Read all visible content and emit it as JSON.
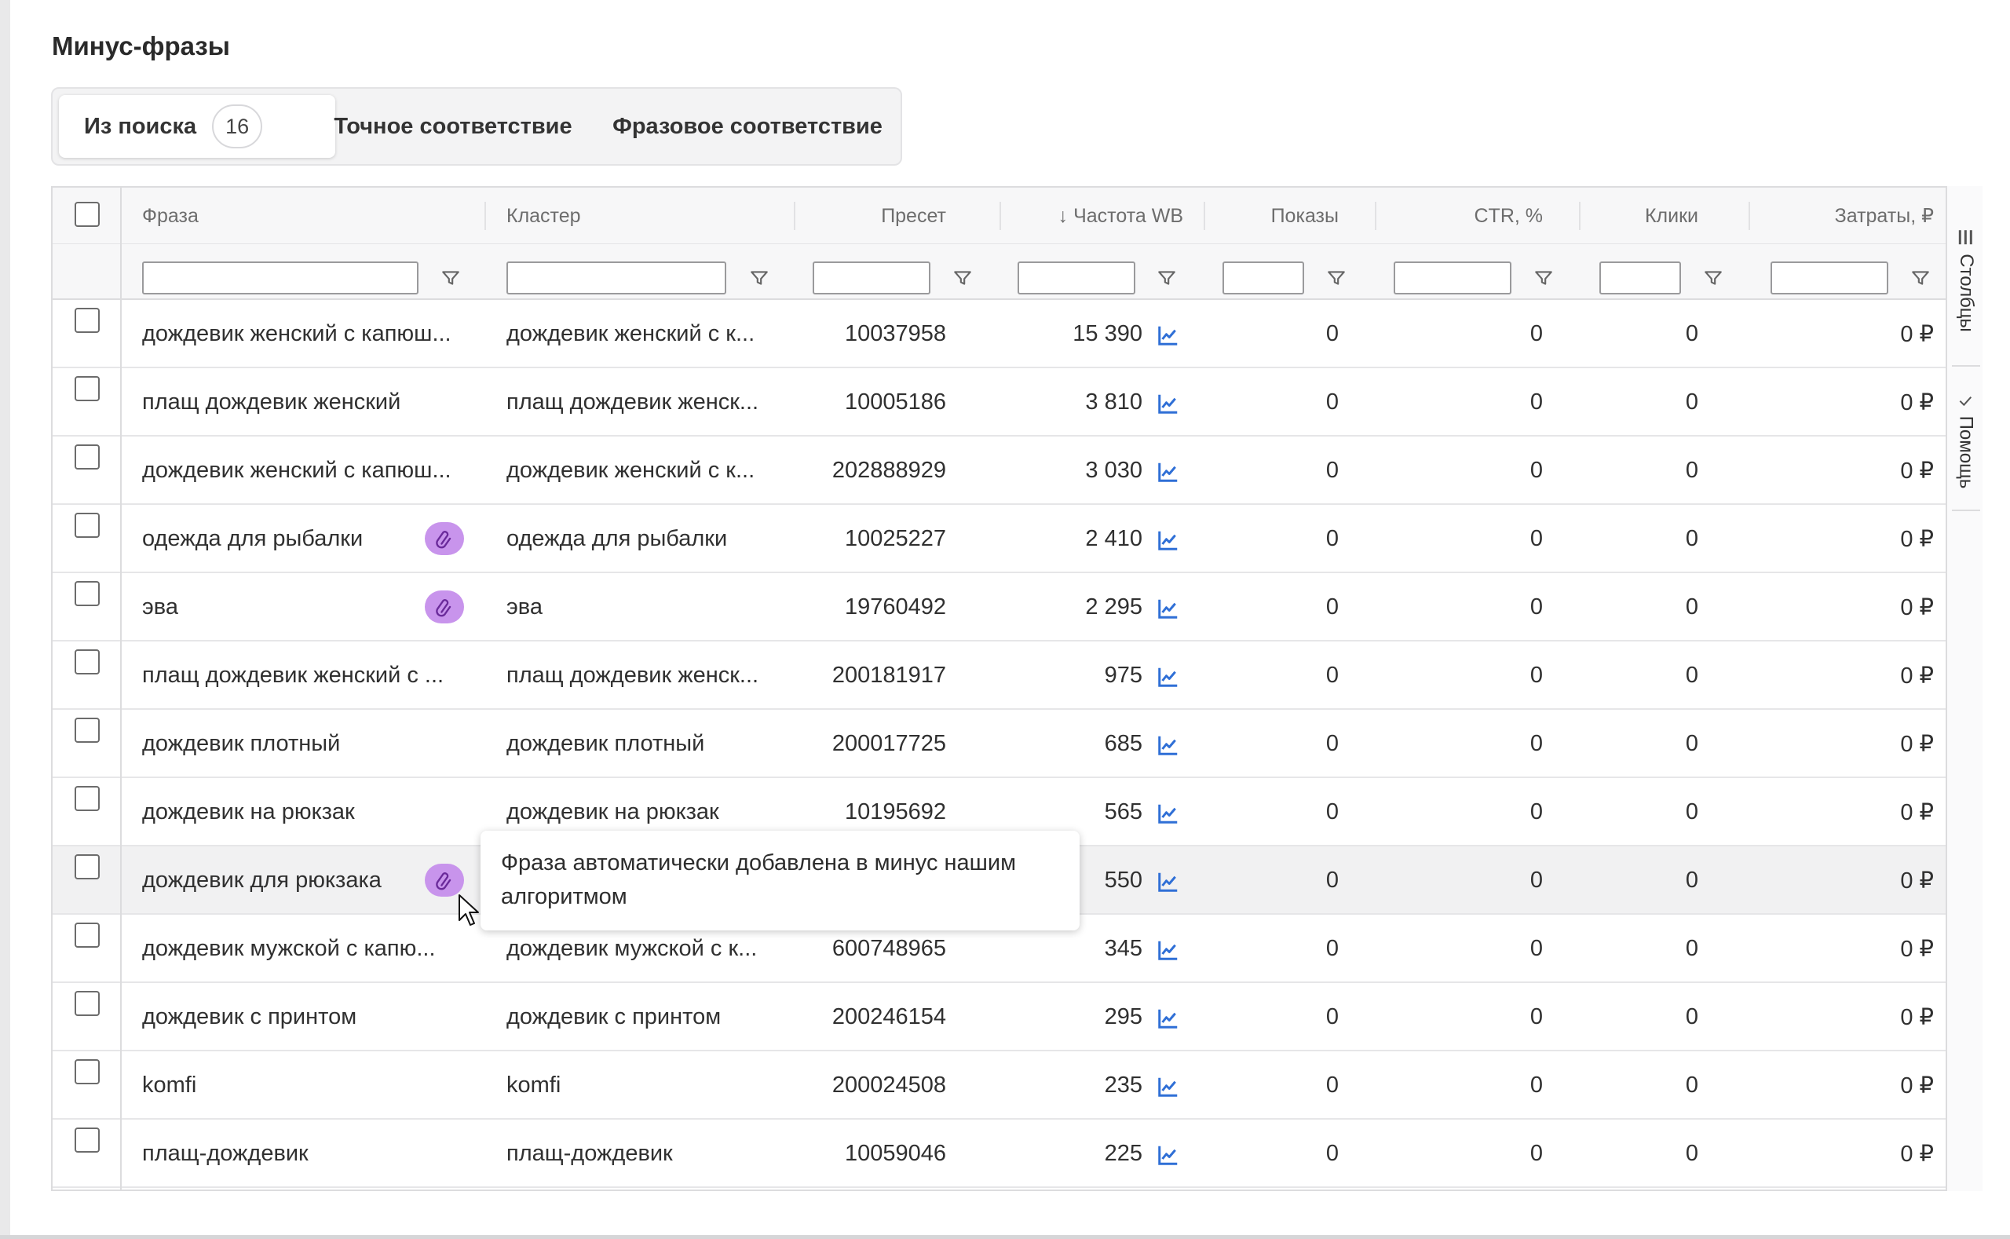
{
  "title": "Минус-фразы",
  "tabs": [
    {
      "label": "Из поиска",
      "badge": "16"
    },
    {
      "label": "Точное соответствие"
    },
    {
      "label": "Фразовое соответствие"
    }
  ],
  "columns": {
    "phrase": "Фраза",
    "cluster": "Кластер",
    "preset": "Пресет",
    "freq": "↓ Частота WB",
    "shows": "Показы",
    "ctr": "CTR, %",
    "clicks": "Клики",
    "cost": "Затраты, ₽"
  },
  "side_panel": {
    "columns": "Столбцы",
    "help": "Помощь"
  },
  "tooltip": "Фраза автоматически добавлена в минус нашим алгоритмом",
  "colors": {
    "auto_badge": "#c894ec",
    "chart_icon": "#2f6fd6"
  },
  "rows": [
    {
      "phrase": "дождевик женский с капюш...",
      "cluster": "дождевик женский с к...",
      "preset": "10037958",
      "freq": "15 390",
      "shows": "0",
      "ctr": "0",
      "clicks": "0",
      "cost": "0 ₽",
      "auto": false
    },
    {
      "phrase": "плащ дождевик женский",
      "cluster": "плащ дождевик женск...",
      "preset": "10005186",
      "freq": "3 810",
      "shows": "0",
      "ctr": "0",
      "clicks": "0",
      "cost": "0 ₽",
      "auto": false
    },
    {
      "phrase": "дождевик женский с капюш...",
      "cluster": "дождевик женский с к...",
      "preset": "202888929",
      "freq": "3 030",
      "shows": "0",
      "ctr": "0",
      "clicks": "0",
      "cost": "0 ₽",
      "auto": false
    },
    {
      "phrase": "одежда для рыбалки",
      "cluster": "одежда для рыбалки",
      "preset": "10025227",
      "freq": "2 410",
      "shows": "0",
      "ctr": "0",
      "clicks": "0",
      "cost": "0 ₽",
      "auto": true
    },
    {
      "phrase": "эва",
      "cluster": "эва",
      "preset": "19760492",
      "freq": "2 295",
      "shows": "0",
      "ctr": "0",
      "clicks": "0",
      "cost": "0 ₽",
      "auto": true
    },
    {
      "phrase": "плащ дождевик женский с ...",
      "cluster": "плащ дождевик женск...",
      "preset": "200181917",
      "freq": "975",
      "shows": "0",
      "ctr": "0",
      "clicks": "0",
      "cost": "0 ₽",
      "auto": false
    },
    {
      "phrase": "дождевик плотный",
      "cluster": "дождевик плотный",
      "preset": "200017725",
      "freq": "685",
      "shows": "0",
      "ctr": "0",
      "clicks": "0",
      "cost": "0 ₽",
      "auto": false
    },
    {
      "phrase": "дождевик на рюкзак",
      "cluster": "дождевик на рюкзак",
      "preset": "10195692",
      "freq": "565",
      "shows": "0",
      "ctr": "0",
      "clicks": "0",
      "cost": "0 ₽",
      "auto": false
    },
    {
      "phrase": "дождевик для рюкзака",
      "cluster": "",
      "preset": "",
      "freq": "550",
      "shows": "0",
      "ctr": "0",
      "clicks": "0",
      "cost": "0 ₽",
      "auto": true
    },
    {
      "phrase": "дождевик мужской с капю...",
      "cluster": "дождевик мужской с к...",
      "preset": "600748965",
      "freq": "345",
      "shows": "0",
      "ctr": "0",
      "clicks": "0",
      "cost": "0 ₽",
      "auto": false
    },
    {
      "phrase": "дождевик с принтом",
      "cluster": "дождевик с принтом",
      "preset": "200246154",
      "freq": "295",
      "shows": "0",
      "ctr": "0",
      "clicks": "0",
      "cost": "0 ₽",
      "auto": false
    },
    {
      "phrase": "komfi",
      "cluster": "komfi",
      "preset": "200024508",
      "freq": "235",
      "shows": "0",
      "ctr": "0",
      "clicks": "0",
      "cost": "0 ₽",
      "auto": false
    },
    {
      "phrase": "плащ-дождевик",
      "cluster": "плащ-дождевик",
      "preset": "10059046",
      "freq": "225",
      "shows": "0",
      "ctr": "0",
      "clicks": "0",
      "cost": "0 ₽",
      "auto": false
    }
  ]
}
